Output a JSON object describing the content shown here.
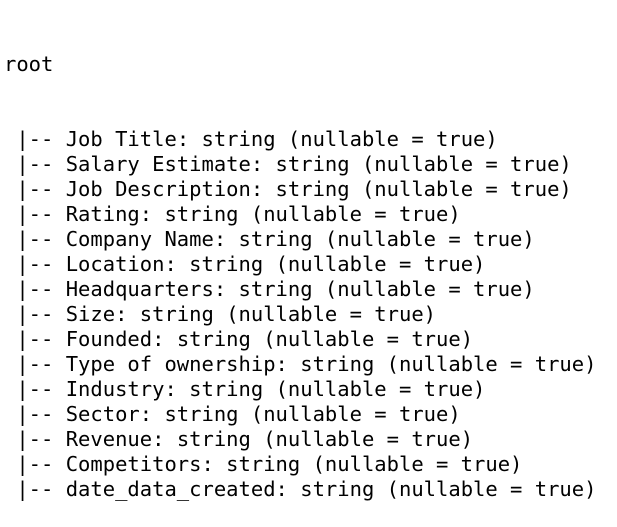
{
  "schema": {
    "root_label": "root",
    "branch_prefix": " |-- ",
    "fields": [
      {
        "name": "Job Title",
        "type": "string",
        "nullable_text": "(nullable = true)"
      },
      {
        "name": "Salary Estimate",
        "type": "string",
        "nullable_text": "(nullable = true)"
      },
      {
        "name": "Job Description",
        "type": "string",
        "nullable_text": "(nullable = true)"
      },
      {
        "name": "Rating",
        "type": "string",
        "nullable_text": "(nullable = true)"
      },
      {
        "name": "Company Name",
        "type": "string",
        "nullable_text": "(nullable = true)"
      },
      {
        "name": "Location",
        "type": "string",
        "nullable_text": "(nullable = true)"
      },
      {
        "name": "Headquarters",
        "type": "string",
        "nullable_text": "(nullable = true)"
      },
      {
        "name": "Size",
        "type": "string",
        "nullable_text": "(nullable = true)"
      },
      {
        "name": "Founded",
        "type": "string",
        "nullable_text": "(nullable = true)"
      },
      {
        "name": "Type of ownership",
        "type": "string",
        "nullable_text": "(nullable = true)"
      },
      {
        "name": "Industry",
        "type": "string",
        "nullable_text": "(nullable = true)"
      },
      {
        "name": "Sector",
        "type": "string",
        "nullable_text": "(nullable = true)"
      },
      {
        "name": "Revenue",
        "type": "string",
        "nullable_text": "(nullable = true)"
      },
      {
        "name": "Competitors",
        "type": "string",
        "nullable_text": "(nullable = true)"
      },
      {
        "name": "date_data_created",
        "type": "string",
        "nullable_text": "(nullable = true)"
      }
    ]
  }
}
